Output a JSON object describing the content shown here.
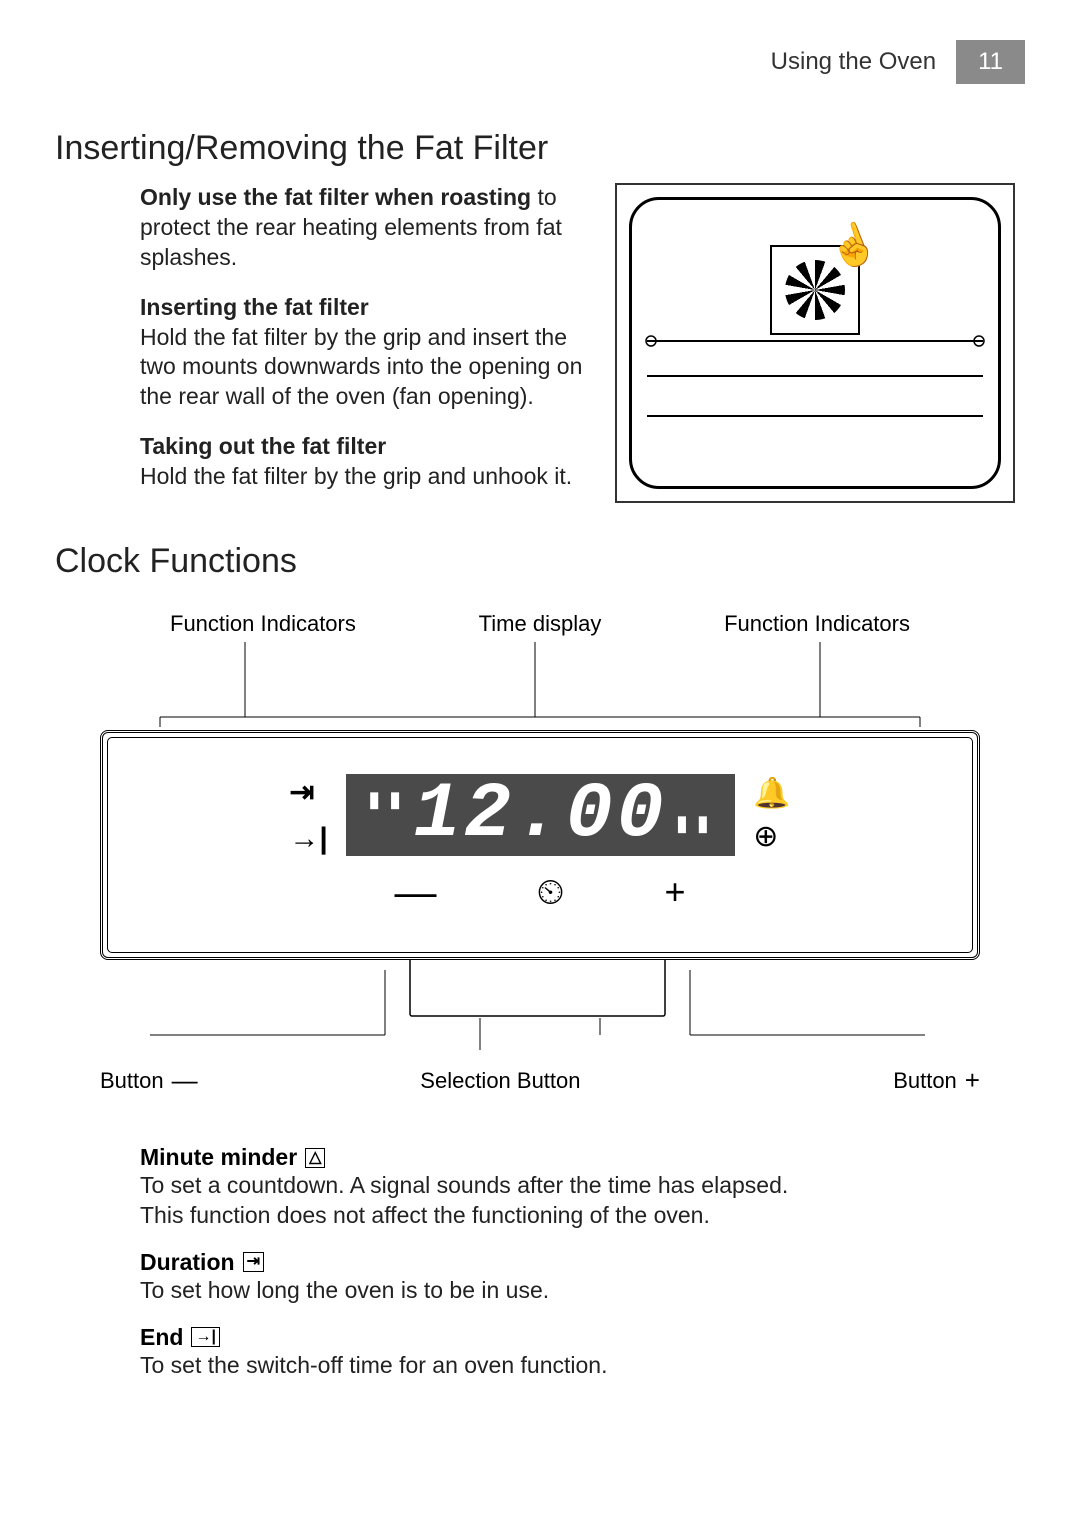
{
  "header": {
    "section_title": "Using the Oven",
    "page_number": "11"
  },
  "fat_filter": {
    "title": "Inserting/Removing the Fat Filter",
    "intro_bold": "Only use the fat filter when roasting",
    "intro_rest": " to protect the rear heating elements from fat splashes.",
    "insert_title": "Inserting the fat filter",
    "insert_text": "Hold the fat filter by the grip and insert the two mounts downwards into the opening on the rear wall of the oven (fan opening).",
    "remove_title": "Taking out the fat filter",
    "remove_text": "Hold the fat filter by the grip and unhook it."
  },
  "clock": {
    "title": "Clock Functions",
    "labels": {
      "function_indicators_left": "Function Indicators",
      "time_display": "Time display",
      "function_indicators_right": "Function Indicators",
      "button_minus": "Button",
      "selection_button": "Selection Button",
      "button_plus": "Button"
    },
    "display_time": "12.00",
    "minute_minder": {
      "title": "Minute minder",
      "desc1": "To set a countdown. A signal sounds after the time has elapsed.",
      "desc2": "This function does not affect the functioning of the oven."
    },
    "duration": {
      "title": "Duration",
      "desc": "To set how long the oven is to be in use."
    },
    "end": {
      "title": "End",
      "desc": "To set the switch-off time for an oven function."
    }
  }
}
